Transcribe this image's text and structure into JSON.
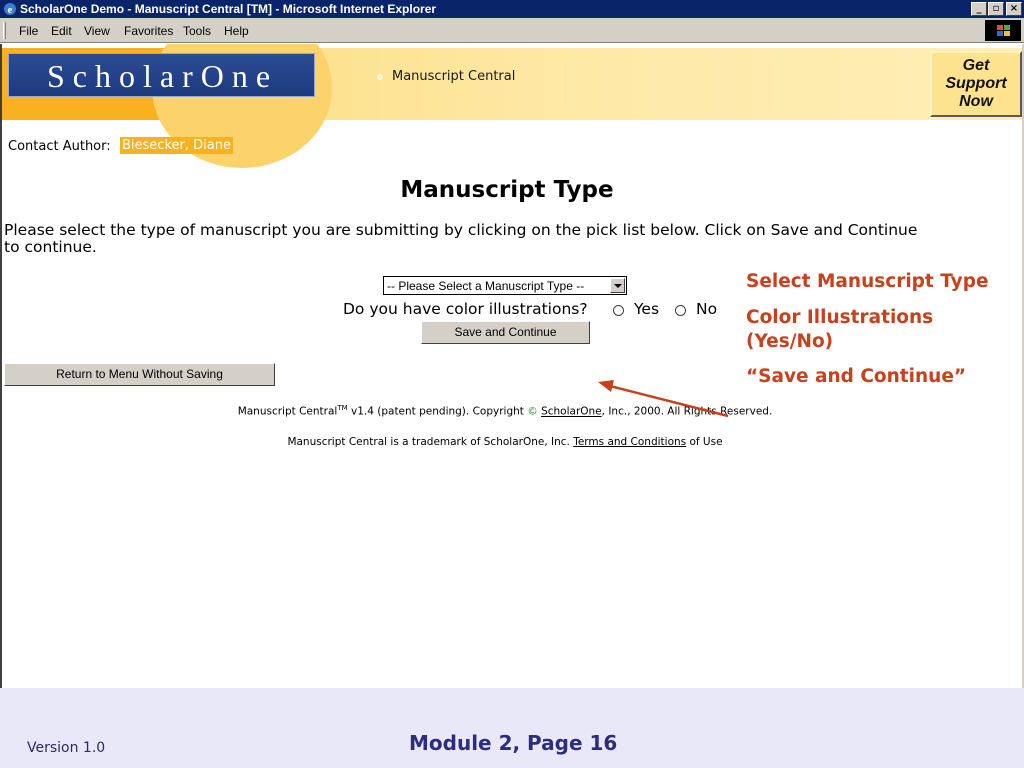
{
  "window": {
    "title": "ScholarOne Demo - Manuscript Central [TM] - Microsoft Internet Explorer",
    "minimize": "_",
    "maximize": "▫",
    "close": "×"
  },
  "menu": {
    "file": "File",
    "edit": "Edit",
    "view": "View",
    "favorites": "Favorites",
    "tools": "Tools",
    "help": "Help"
  },
  "banner": {
    "logo": "ScholarOne",
    "label": "Manuscript Central",
    "support_line1": "Get",
    "support_line2": "Support",
    "support_line3": "Now"
  },
  "contact": {
    "label": "Contact Author:",
    "name": "Biesecker, Diane"
  },
  "page": {
    "title": "Manuscript Type",
    "instructions_pre": "Please select the type of manuscript you are submitting by clicking on the pick list below. Click on ",
    "instructions_bold": "Save and Continue",
    "instructions_post": " to continue."
  },
  "form": {
    "select_value": "-- Please Select a Manuscript Type --",
    "color_question": "Do you have color illustrations?",
    "yes_label": "Yes",
    "no_label": "No",
    "save_button": "Save and Continue",
    "return_button": "Return to Menu Without Saving"
  },
  "footer": {
    "line1_product": "Manuscript Central",
    "line1_tm": "TM",
    "line1_version": " v1.4 (patent pending). Copyright ",
    "line1_copy_symbol": "©",
    "line1_company": "ScholarOne",
    "line1_rest": ", Inc., 2000. All Rights Reserved.",
    "line2_pre": "Manuscript Central is a trademark of ScholarOne, Inc. ",
    "line2_link": "Terms and Conditions",
    "line2_post": " of Use"
  },
  "annotations": {
    "select_note": "Select Manuscript Type",
    "color_note_line1": "Color Illustrations",
    "color_note_line2": "(Yes/No)",
    "save_note": "“Save and Continue”"
  },
  "slide": {
    "version": "Version 1.0",
    "module": "Module 2, Page 16"
  },
  "colors": {
    "annotation": "#c8401c",
    "banner_orange": "#f8b21f",
    "logo_blue": "#1c3a80",
    "slide_text": "#2c2c80"
  }
}
